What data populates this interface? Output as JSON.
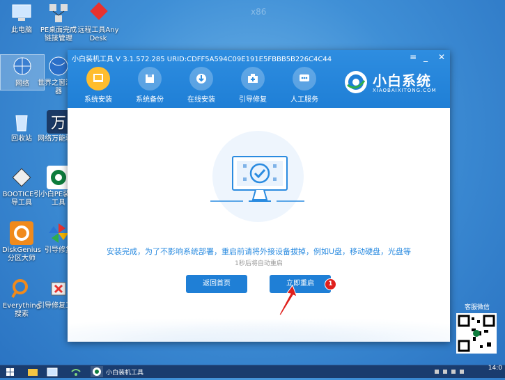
{
  "desktop": {
    "watermark": "x86",
    "icons": [
      {
        "label": "此电脑"
      },
      {
        "label": "PE桌面完成链接管理"
      },
      {
        "label": "远程工具AnyDesk"
      },
      {
        "label": "网络"
      },
      {
        "label": "世界之窗浏览器"
      },
      {
        "label": "回收站"
      },
      {
        "label": "网络万能驱动"
      },
      {
        "label": "BOOTICE引导工具"
      },
      {
        "label": "小白PE装机工具"
      },
      {
        "label": "DiskGenius分区大师"
      },
      {
        "label": "引导修复"
      },
      {
        "label": "Everything搜索"
      },
      {
        "label": "引导修复工具"
      }
    ],
    "qr_label": "客服微信"
  },
  "window": {
    "title": "小白装机工具 V 3.1.572.285 URID:CDFF5A594C09E191E5FBBB5B226C4C44",
    "menu_icon": "menu-icon",
    "minimize_icon": "minimize-icon",
    "close_icon": "close-icon",
    "nav": [
      {
        "label": "系统安装",
        "icon": "system-install-icon",
        "active": true
      },
      {
        "label": "系统备份",
        "icon": "backup-icon",
        "active": false
      },
      {
        "label": "在线安装",
        "icon": "online-install-icon",
        "active": false
      },
      {
        "label": "引导修复",
        "icon": "boot-repair-icon",
        "active": false
      },
      {
        "label": "人工服务",
        "icon": "service-icon",
        "active": false
      }
    ],
    "brand": {
      "name": "小白系统",
      "sub": "XIAOBAIXITONG.COM"
    }
  },
  "content": {
    "message": "安装完成，为了不影响系统部署，重启前请将外接设备拔掉，例如U盘，移动硬盘，光盘等",
    "countdown": "1秒后将自动重启",
    "back_button": "返回首页",
    "restart_button": "立即重启",
    "badge": "1"
  },
  "taskbar": {
    "app_label": "小白装机工具",
    "clock": "14:0"
  },
  "colors": {
    "accent": "#1f7fd6",
    "active_nav": "#ffbd2e",
    "badge": "#e0201c",
    "arrow": "#e0201c"
  }
}
